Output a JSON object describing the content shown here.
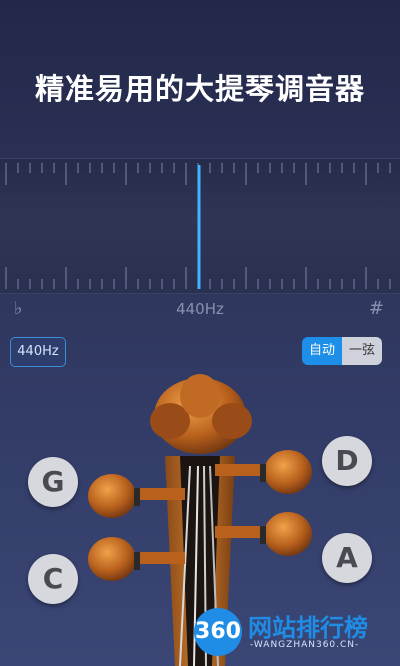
{
  "headline": "精准易用的大提琴调音器",
  "note_row": {
    "flat": "♭",
    "frequency": "440Hz",
    "sharp": "#"
  },
  "controls": {
    "hz_button": "440Hz",
    "mode_auto": "自动",
    "mode_single": "一弦"
  },
  "pegs": {
    "g": "G",
    "c": "C",
    "d": "D",
    "a": "A"
  },
  "watermark": {
    "badge": "360",
    "title": "网站排行榜",
    "subtitle": "-WANGZHAN360.CN-"
  },
  "colors": {
    "accent": "#1e8fe8",
    "indicator": "#3fb6ff",
    "background": "#2d3458"
  }
}
